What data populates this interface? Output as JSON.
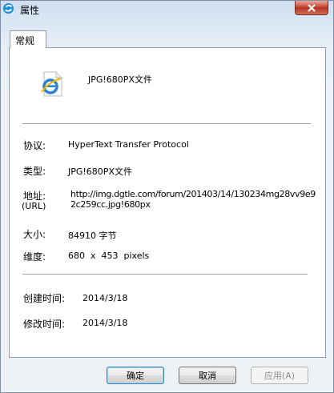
{
  "window": {
    "title": "属性"
  },
  "tabs": [
    {
      "label": "常规"
    }
  ],
  "file": {
    "name": "JPG!680PX文件"
  },
  "props": {
    "protocol": {
      "label": "协议:",
      "value": "HyperText Transfer Protocol"
    },
    "type": {
      "label": "类型:",
      "value": "JPG!680PX文件"
    },
    "address": {
      "label": "地址:",
      "sublabel": "(URL)",
      "line1": "http://img.dgtle.com/forum/201403/14/130234mg28vv9e9",
      "line2": "2c259cc.jpg!680px"
    },
    "size": {
      "label": "大小:",
      "value": "84910 字节"
    },
    "dimensions": {
      "label": "维度:",
      "value": "680  x  453  pixels"
    },
    "created": {
      "label": "创建时间:",
      "value": "2014/3/18"
    },
    "modified": {
      "label": "修改时间:",
      "value": "2014/3/18"
    }
  },
  "buttons": {
    "ok": "确定",
    "cancel": "取消",
    "apply": "应用(A)"
  },
  "icons": {
    "app": "browser-logo-icon",
    "file": "ie-document-icon",
    "close": "close-icon"
  }
}
